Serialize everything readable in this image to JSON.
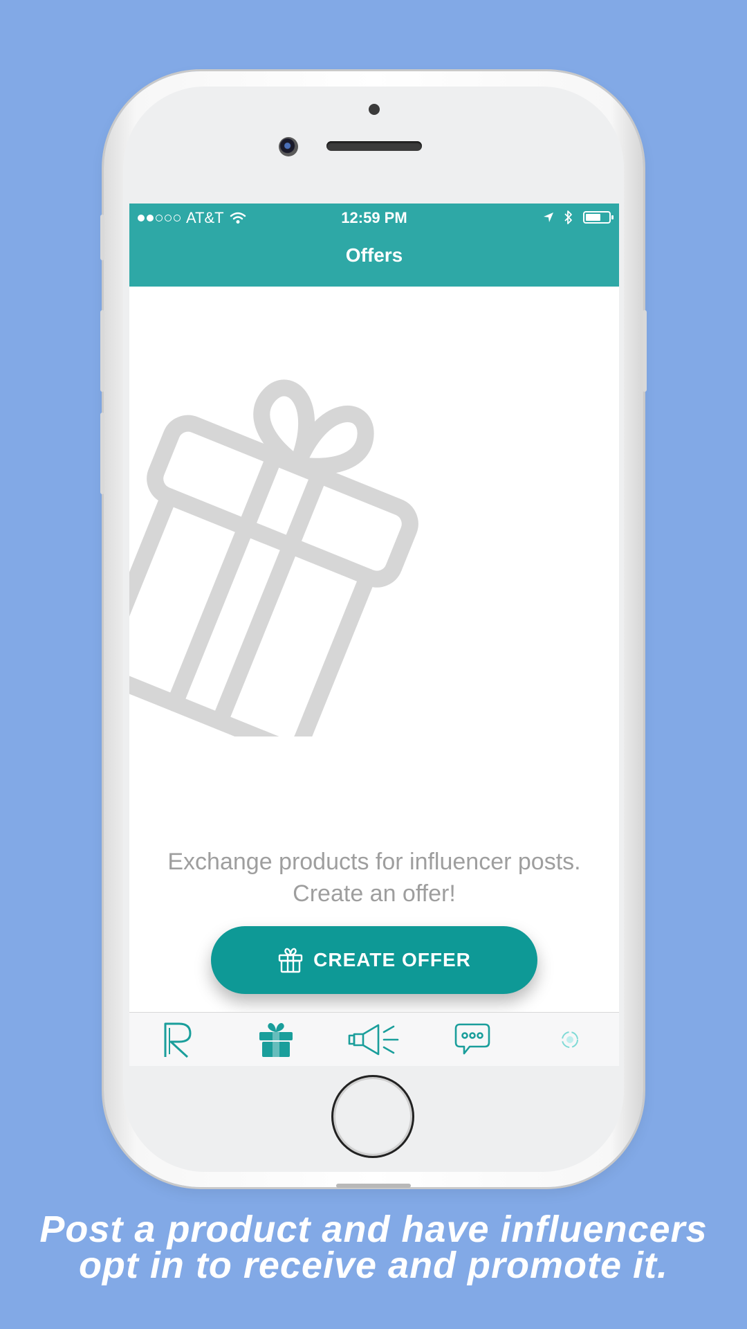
{
  "status_bar": {
    "carrier": "AT&T",
    "time": "12:59 PM",
    "signal_bars_filled": 2,
    "signal_bars_total": 5,
    "battery_level": 0.65
  },
  "nav": {
    "title": "Offers"
  },
  "empty_state": {
    "icon": "gift-icon",
    "message": "Exchange products for influencer posts. Create an offer!"
  },
  "create_button": {
    "label": "CREATE OFFER",
    "icon": "gift-icon"
  },
  "tab_bar": {
    "tabs": [
      {
        "icon": "r-logo-icon",
        "active": false
      },
      {
        "icon": "gift-icon",
        "active": true
      },
      {
        "icon": "megaphone-icon",
        "active": false
      },
      {
        "icon": "chat-bubble-icon",
        "active": false
      },
      {
        "icon": "profile-refresh-icon",
        "active": false
      }
    ]
  },
  "caption": {
    "line1": "Post a product and have influencers",
    "line2": "opt in to receive and promote it."
  },
  "colors": {
    "background": "#82a9e6",
    "accent": "#2ea8a6",
    "button": "#0e9996",
    "muted_text": "#9e9e9e"
  }
}
